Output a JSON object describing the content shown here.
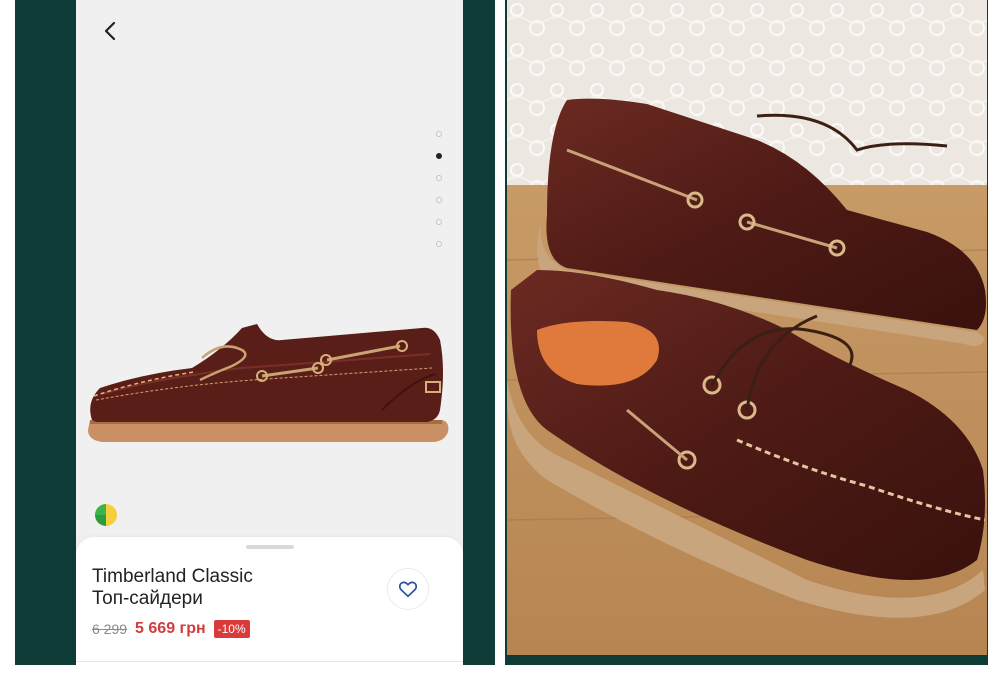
{
  "product": {
    "title_line1": "Timberland Classic",
    "title_line2": "Топ-сайдери",
    "old_price": "6 299",
    "new_price": "5 669 грн",
    "discount": "-10%",
    "gallery_dots": 6,
    "active_dot": 1
  },
  "colors": {
    "frame": "#0e3b35",
    "price_red": "#d23c3c",
    "badge_red": "#d93a3a"
  },
  "icons": [
    "chevron-left-icon",
    "heart-icon",
    "brand-logo-icon"
  ]
}
